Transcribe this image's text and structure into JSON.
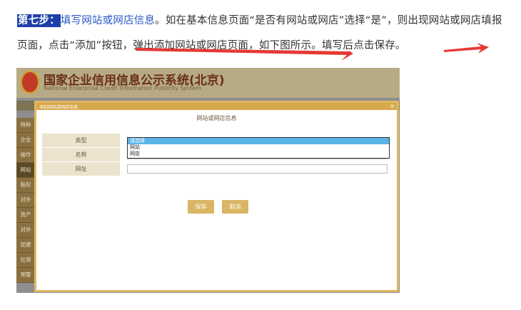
{
  "doc": {
    "step_label": "第七步：",
    "step_title": "填写网站或网店信息",
    "text_part1": "。如在基本信息页面“是否有网站或网店”选择“是”，则出现网站或网店填报页面，点击“添加”按钮，弹出添加网站或网店页面，如下图所示。填写后点击保存。"
  },
  "screenshot": {
    "banner_title": "国家企业信用信息公示系统(北京)",
    "banner_subtitle": "National Enterprise Credit Information Publicity System",
    "sidebar_items": [
      "特种",
      "企业",
      "操作",
      "网站",
      "股权",
      "对外",
      "资产",
      "对外",
      "党建",
      "社保",
      "预警"
    ],
    "modal_title": "添加网站或网店信息",
    "modal_close": "×",
    "modal_heading": "网站或网店信息",
    "form": {
      "type_label": "类型",
      "name_label": "名称",
      "url_label": "网址"
    },
    "dropdown_options": [
      "请选择",
      "网站",
      "网店"
    ],
    "save_label": "保存",
    "cancel_label": "取消"
  },
  "colors": {
    "highlight": "#1e3fa8",
    "link": "#2a57c7",
    "arrow": "#e53935",
    "banner": "#b7ab86",
    "button": "#d8b665"
  }
}
